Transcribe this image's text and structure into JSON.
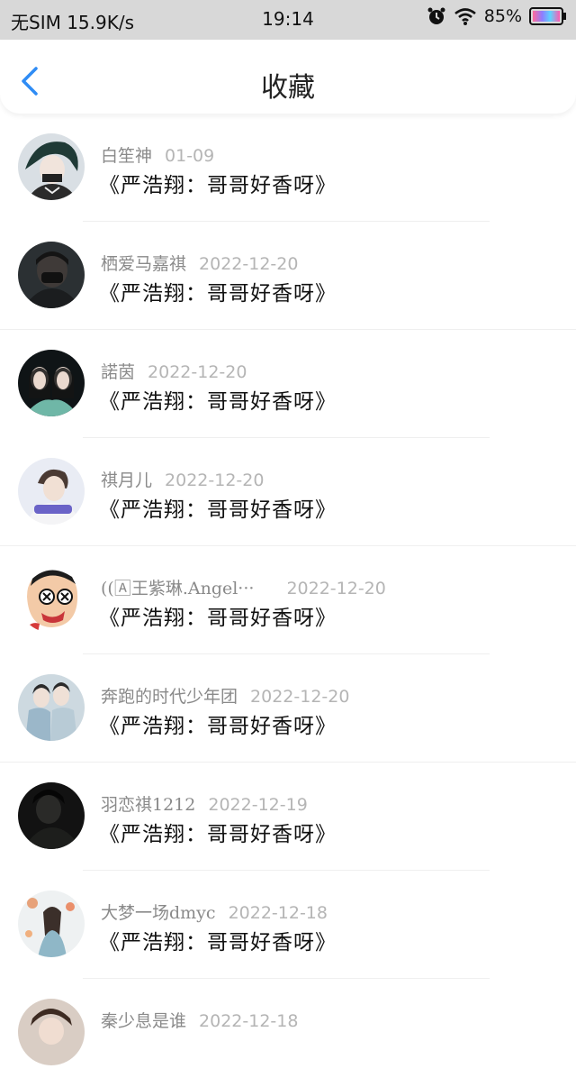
{
  "status_bar": {
    "carrier": "无SIM 15.9K/s",
    "time": "19:14",
    "battery": "85%",
    "icons": [
      "alarm-icon",
      "wifi-icon",
      "battery-icon"
    ]
  },
  "nav": {
    "back_icon": "chevron-left-icon",
    "title": "收藏",
    "accent": "#2f8cf5"
  },
  "items": [
    {
      "name": "白笙神",
      "date": "01-09",
      "content": "《严浩翔：哥哥好香呀》",
      "avatar_color": "#cfd6dc"
    },
    {
      "name": "栖爱马嘉祺",
      "date": "2022-12-20",
      "content": "《严浩翔：哥哥好香呀》",
      "avatar_color": "#3a3f42"
    },
    {
      "name": "諾茵",
      "date": "2022-12-20",
      "content": "《严浩翔：哥哥好香呀》",
      "avatar_color": "#1c2326"
    },
    {
      "name": "祺月儿",
      "date": "2022-12-20",
      "content": "《严浩翔：哥哥好香呀》",
      "avatar_color": "#c6cbe2"
    },
    {
      "name": "((🄰王紫琳.Angel···",
      "date": "2022-12-20",
      "content": "《严浩翔：哥哥好香呀》",
      "avatar_color": "#f2c9a6"
    },
    {
      "name": "奔跑的时代少年团",
      "date": "2022-12-20",
      "content": "《严浩翔：哥哥好香呀》",
      "avatar_color": "#b9cad4"
    },
    {
      "name": "羽恋祺1212",
      "date": "2022-12-19",
      "content": "《严浩翔：哥哥好香呀》",
      "avatar_color": "#1a1a1a"
    },
    {
      "name": "大梦一场dmyc",
      "date": "2022-12-18",
      "content": "《严浩翔：哥哥好香呀》",
      "avatar_color": "#e5d8cc"
    },
    {
      "name": "秦少息是谁",
      "date": "2022-12-18",
      "content": "",
      "avatar_color": "#5d4a3f"
    }
  ]
}
